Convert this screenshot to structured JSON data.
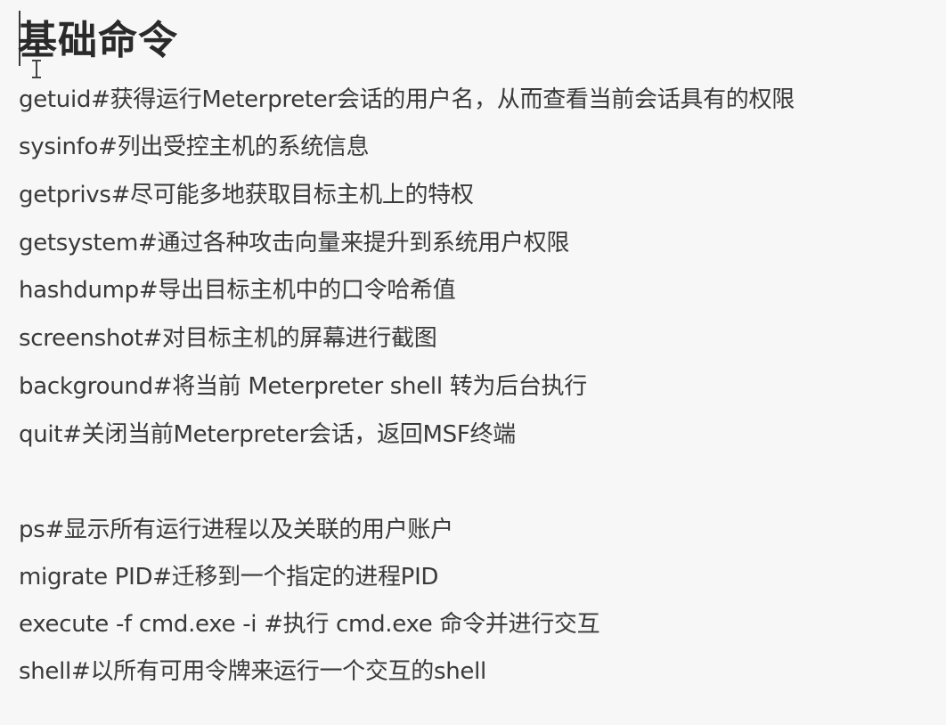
{
  "heading": "基础命令",
  "commands_group1": [
    "getuid#获得运行Meterpreter会话的用户名，从而查看当前会话具有的权限",
    "sysinfo#列出受控主机的系统信息",
    "getprivs#尽可能多地获取目标主机上的特权",
    "getsystem#通过各种攻击向量来提升到系统用户权限",
    "hashdump#导出目标主机中的口令哈希值",
    "screenshot#对目标主机的屏幕进行截图",
    "background#将当前 Meterpreter shell 转为后台执行",
    "quit#关闭当前Meterpreter会话，返回MSF终端"
  ],
  "commands_group2": [
    "ps#显示所有运行进程以及关联的用户账户",
    "migrate PID#迁移到一个指定的进程PID",
    "execute -f cmd.exe -i #执行 cmd.exe 命令并进行交互",
    "shell#以所有可用令牌来运行一个交互的shell"
  ]
}
